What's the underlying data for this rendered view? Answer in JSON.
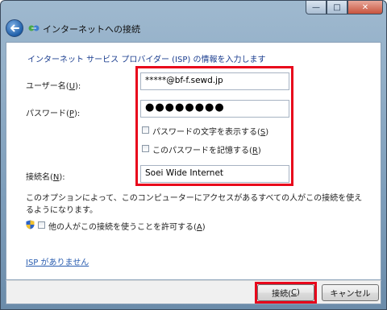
{
  "window": {
    "title": "インターネットへの接続",
    "caption_min": "—",
    "caption_max": "□",
    "caption_close": "✕",
    "back_icon": "back-arrow-icon",
    "network_icon": "network-connection-icon"
  },
  "form": {
    "heading": "インターネット サービス プロバイダー (ISP) の情報を入力します",
    "username": {
      "label": "ユーザー名(",
      "accel": "U",
      "label_end": "):",
      "value": "*****@bf-f.sewd.jp"
    },
    "password": {
      "label": "パスワード(",
      "accel": "P",
      "label_end": "):",
      "value": "●●●●●●●●"
    },
    "show_chars": {
      "label": "パスワードの文字を表示する(",
      "accel": "S",
      "label_end": ")",
      "checked": false
    },
    "remember": {
      "label": "このパスワードを記憶する(",
      "accel": "R",
      "label_end": ")",
      "checked": false
    },
    "connection_name": {
      "label": "接続名(",
      "accel": "N",
      "label_end": "):",
      "value": "Soei Wide Internet"
    },
    "description": "このオプションによって、このコンピューターにアクセスがあるすべての人がこの接続を使えるようになります。",
    "allow_others": {
      "label": "他の人がこの接続を使うことを許可する(",
      "accel": "A",
      "label_end": ")",
      "checked": false
    },
    "no_isp_link": "ISP がありません"
  },
  "buttons": {
    "connect": {
      "label": "接続(",
      "accel": "C",
      "label_end": ")"
    },
    "cancel": "キャンセル"
  },
  "colors": {
    "highlight": "#e8061b",
    "heading": "#1a3d8f",
    "link": "#2a5db0"
  }
}
